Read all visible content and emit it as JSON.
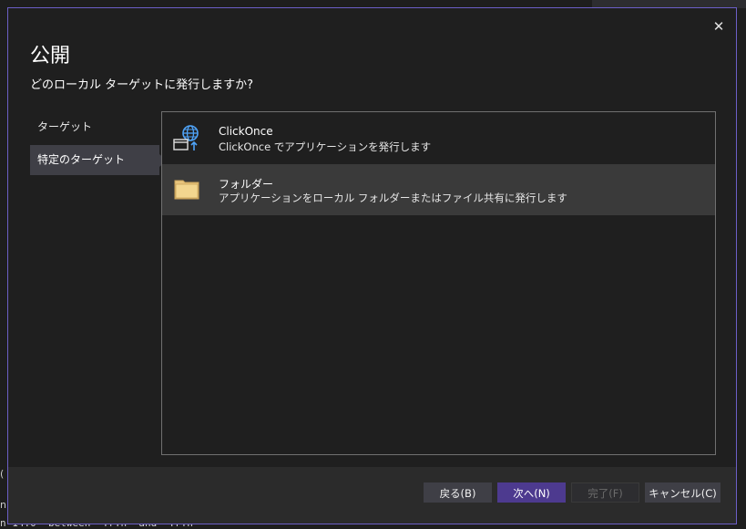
{
  "dialog": {
    "title": "公開",
    "subtitle": "どのローカル ターゲットに発行しますか?",
    "close_symbol": "✕"
  },
  "steps": [
    {
      "label": "ターゲット",
      "active": false
    },
    {
      "label": "特定のターゲット",
      "active": true
    }
  ],
  "options": [
    {
      "name": "ClickOnce",
      "description": "ClickOnce でアプリケーションを発行します",
      "icon": "clickonce-icon",
      "selected": false
    },
    {
      "name": "フォルダー",
      "description": "アプリケーションをローカル フォルダーまたはファイル共有に発行します",
      "icon": "folder-icon",
      "selected": true
    }
  ],
  "buttons": {
    "back": "戻る(B)",
    "next": "次へ(N)",
    "finish": "完了(F)",
    "cancel": "キャンセル(C)"
  },
  "background": {
    "code_line": "n 14:0  between \"¥r¥n\" and \"¥r¥n\"",
    "frag1": "(",
    "frag2": "n"
  },
  "colors": {
    "accent": "#4d3a8f",
    "dialog_border": "#6c5fc7",
    "selected_row": "#3a3a3a"
  }
}
